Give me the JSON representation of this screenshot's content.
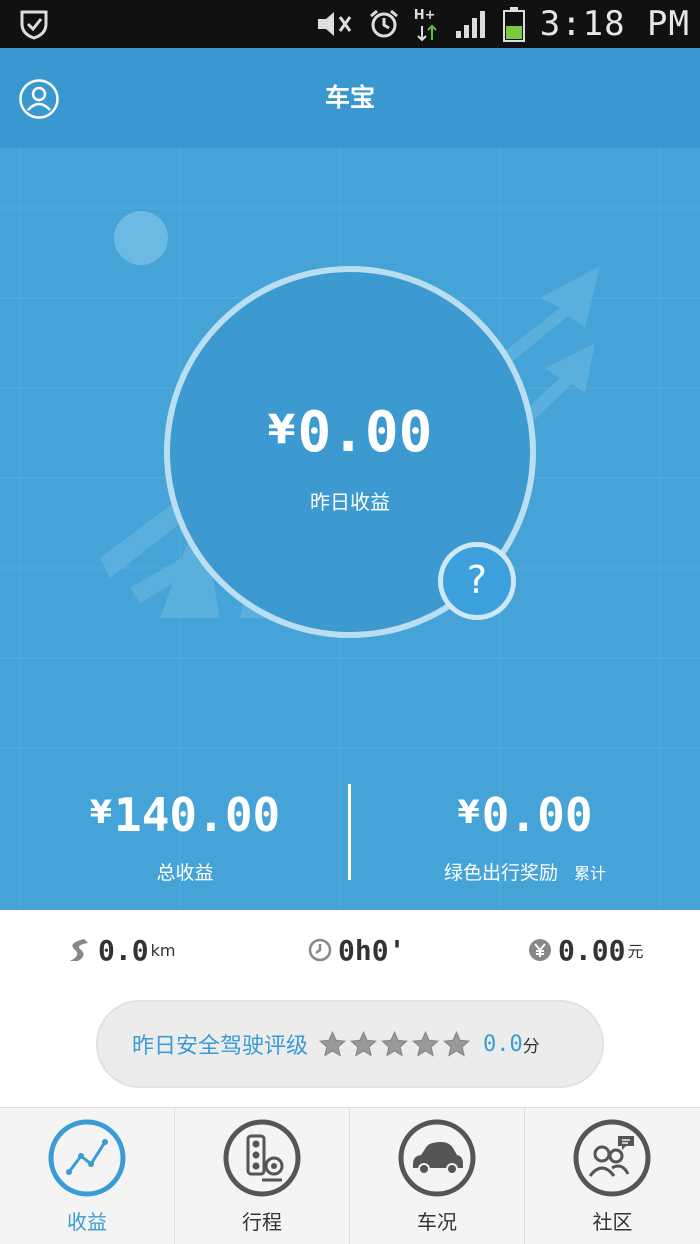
{
  "status_bar": {
    "time": "3:18 PM",
    "network": "H+"
  },
  "header": {
    "title": "车宝"
  },
  "hero": {
    "currency": "¥",
    "yesterday_amount": "0.00",
    "yesterday_label": "昨日收益",
    "help_label": "?",
    "total_amount": "140.00",
    "total_label": "总收益",
    "green_amount": "0.00",
    "green_label": "绿色出行奖励",
    "green_sub": "累计"
  },
  "summary": {
    "distance_value": "0.0",
    "distance_unit": "km",
    "time_value": "0h0'",
    "money_value": "0.00",
    "money_unit": "元"
  },
  "rating": {
    "label": "昨日安全驾驶评级",
    "stars_total": 5,
    "stars_filled": 0,
    "score": "0.0",
    "unit": "分"
  },
  "tabs": [
    {
      "label": "收益",
      "icon": "chart-line-icon",
      "active": true
    },
    {
      "label": "行程",
      "icon": "traffic-light-icon",
      "active": false
    },
    {
      "label": "车况",
      "icon": "car-icon",
      "active": false
    },
    {
      "label": "社区",
      "icon": "community-icon",
      "active": false
    }
  ],
  "colors": {
    "primary": "#3b9bd4",
    "header_bg": "#3a98d0",
    "hero_bg": "#45a3d8"
  }
}
